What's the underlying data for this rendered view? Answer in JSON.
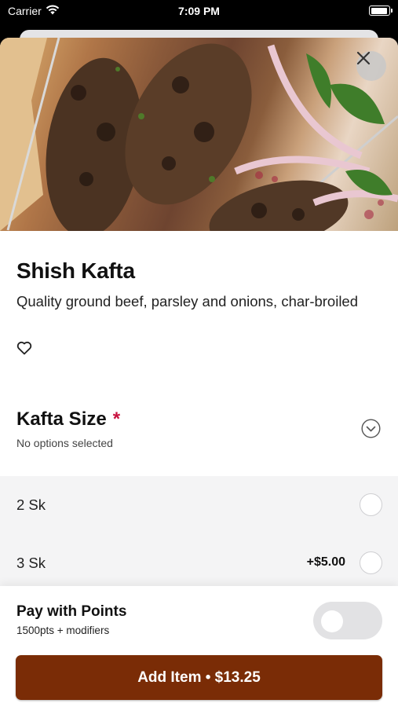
{
  "status_bar": {
    "carrier": "Carrier",
    "time": "7:09 PM"
  },
  "item": {
    "title": "Shish Kafta",
    "description": "Quality ground beef, parsley and onions, char-broiled"
  },
  "modifier_group": {
    "title": "Kafta Size",
    "required_marker": "*",
    "subtitle": "No options selected",
    "options": [
      {
        "label": "2 Sk",
        "price": ""
      },
      {
        "label": "3 Sk",
        "price": "+$5.00"
      }
    ]
  },
  "points": {
    "title": "Pay with Points",
    "subtitle": "1500pts + modifiers",
    "enabled": false
  },
  "add_button": {
    "label": "Add Item • $13.25"
  },
  "colors": {
    "accent": "#7a2c06",
    "required": "#c8103e"
  },
  "icons": [
    "wifi-icon",
    "battery-icon",
    "close-icon",
    "heart-icon",
    "chevron-down-icon"
  ]
}
